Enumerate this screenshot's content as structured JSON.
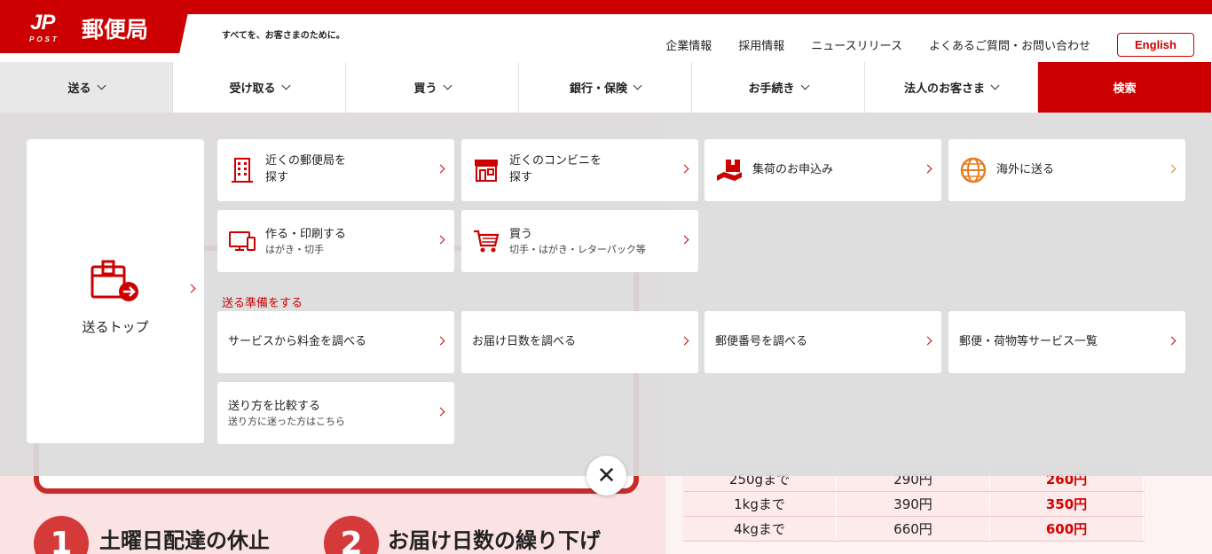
{
  "header": {
    "logo_mark": "JP",
    "logo_post": "POST",
    "logo_name": "郵便局",
    "tagline": "すべてを、お客さまのために。",
    "util_links": [
      "企業情報",
      "採用情報",
      "ニュースリリース",
      "よくあるご質問・お問い合わせ"
    ],
    "english_label": "English",
    "brand_color": "#cc0000"
  },
  "nav": {
    "items": [
      {
        "label": "送る"
      },
      {
        "label": "受け取る"
      },
      {
        "label": "買う"
      },
      {
        "label": "銀行・保険"
      },
      {
        "label": "お手続き"
      },
      {
        "label": "法人のお客さま"
      }
    ],
    "search_label": "検索"
  },
  "menu": {
    "top_label": "送るトップ",
    "cards": [
      {
        "title": "近くの郵便局を\n探す",
        "icon": "post-office-icon"
      },
      {
        "title": "近くのコンビニを\n探す",
        "icon": "convenience-store-icon"
      },
      {
        "title": "集荷のお申込み",
        "icon": "pickup-truck-icon"
      },
      {
        "title": "海外に送る",
        "icon": "globe-icon"
      },
      {
        "title": "作る・印刷する",
        "sub": "はがき・切手",
        "icon": "computer-icon"
      },
      {
        "title": "買う",
        "sub": "切手・はがき・レターパック等",
        "icon": "shopping-cart-icon"
      }
    ],
    "prep_label": "送る準備をする",
    "prep_cards": [
      {
        "title": "サービスから料金を調べる"
      },
      {
        "title": "お届け日数を調べる"
      },
      {
        "title": "郵便番号を調べる"
      },
      {
        "title": "郵便・荷物等サービス一覧"
      },
      {
        "title": "送り方を比較する",
        "sub": "送り方に迷った方はこちら"
      }
    ],
    "close_label": "✕"
  },
  "background": {
    "headings": [
      "土曜日配達の休止",
      "お届け日数の繰り下げ"
    ],
    "numbers": [
      "1",
      "2"
    ],
    "table": [
      [
        "250gまで",
        "290円",
        "260円"
      ],
      [
        "1kgまで",
        "390円",
        "350円"
      ],
      [
        "4kgまで",
        "660円",
        "600円"
      ]
    ]
  }
}
